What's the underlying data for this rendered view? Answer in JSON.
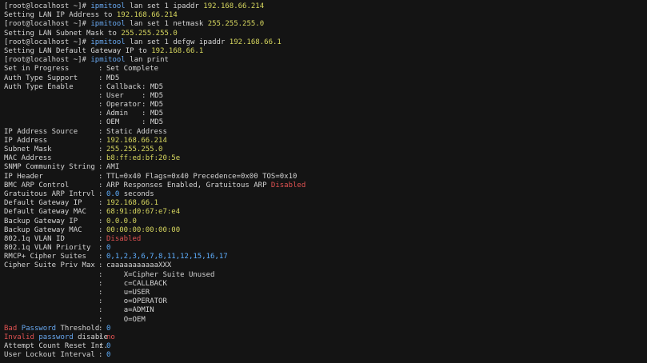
{
  "colors": {
    "background": "#141414",
    "text": "#d4d4d4",
    "command": "#68a8f0",
    "value_yellow": "#d7d75f",
    "value_blue": "#5fafff",
    "value_red": "#e05252"
  },
  "session": {
    "prompt": "[root@localhost ~]#",
    "commands": [
      {
        "tool": "ipmitool",
        "args": "lan set 1 ipaddr",
        "value": "192.168.66.214",
        "output_prefix": "Setting LAN IP Address to",
        "output_value": "192.168.66.214"
      },
      {
        "tool": "ipmitool",
        "args": "lan set 1 netmask",
        "value": "255.255.255.0",
        "output_prefix": "Setting LAN Subnet Mask to",
        "output_value": "255.255.255.0"
      },
      {
        "tool": "ipmitool",
        "args": "lan set 1 defgw ipaddr",
        "value": "192.168.66.1",
        "output_prefix": "Setting LAN Default Gateway IP to",
        "output_value": "192.168.66.1"
      },
      {
        "tool": "ipmitool",
        "args": "lan print"
      }
    ]
  },
  "lan_print": {
    "set_in_progress": {
      "key": "Set in Progress",
      "value": "Set Complete"
    },
    "auth_type_support": {
      "key": "Auth Type Support",
      "value": "MD5"
    },
    "auth_type_enable": {
      "key": "Auth Type Enable",
      "rows": [
        {
          "name": "Callback",
          "value": "MD5"
        },
        {
          "name": "User",
          "value": "MD5"
        },
        {
          "name": "Operator",
          "value": "MD5"
        },
        {
          "name": "Admin",
          "value": "MD5"
        },
        {
          "name": "OEM",
          "value": "MD5"
        }
      ]
    },
    "ip_address_source": {
      "key": "IP Address Source",
      "value": "Static Address"
    },
    "ip_address": {
      "key": "IP Address",
      "value": "192.168.66.214"
    },
    "subnet_mask": {
      "key": "Subnet Mask",
      "value": "255.255.255.0"
    },
    "mac_address": {
      "key": "MAC Address",
      "value": "b8:ff:ed:bf:20:5e"
    },
    "snmp_community": {
      "key": "SNMP Community String",
      "value": "AMI"
    },
    "ip_header": {
      "key": "IP Header",
      "value": "TTL=0x40 Flags=0x40 Precedence=0x00 TOS=0x10"
    },
    "bmc_arp_control": {
      "key": "BMC ARP Control",
      "value": "ARP Responses Enabled, Gratuitous ARP",
      "value_flag": "Disabled"
    },
    "gratuitous_arp": {
      "key": "Gratuitous ARP Intrvl",
      "value_num": "0.0",
      "value_unit": "seconds"
    },
    "default_gateway_ip": {
      "key": "Default Gateway IP",
      "value": "192.168.66.1"
    },
    "default_gateway_mac": {
      "key": "Default Gateway MAC",
      "value": "68:91:d0:67:e7:e4"
    },
    "backup_gateway_ip": {
      "key": "Backup Gateway IP",
      "value": "0.0.0.0"
    },
    "backup_gateway_mac": {
      "key": "Backup Gateway MAC",
      "value": "00:00:00:00:00:00"
    },
    "vlan_id": {
      "key": "802.1q VLAN ID",
      "value": "Disabled"
    },
    "vlan_priority": {
      "key": "802.1q VLAN Priority",
      "value": "0"
    },
    "rmcp_cipher": {
      "key": "RMCP+ Cipher Suites",
      "value": "0,1,2,3,6,7,8,11,12,15,16,17"
    },
    "cipher_priv_max": {
      "key": "Cipher Suite Priv Max",
      "value": "caaaaaaaaaaaXXX",
      "legend": [
        "X=Cipher Suite Unused",
        "c=CALLBACK",
        "u=USER",
        "o=OPERATOR",
        "a=ADMIN",
        "O=OEM"
      ]
    },
    "bad_password_threshold": {
      "key_red": "Bad",
      "key_blue": "Password",
      "key_rest": "Threshold",
      "value": "0"
    },
    "invalid_password_disable": {
      "key_red": "Invalid",
      "key_blue": "password",
      "key_rest": "disable",
      "value": "no"
    },
    "attempt_count_reset": {
      "key": "Attempt Count Reset Int.",
      "value": "0"
    },
    "user_lockout_interval": {
      "key": "User Lockout Interval",
      "value": "0"
    }
  }
}
